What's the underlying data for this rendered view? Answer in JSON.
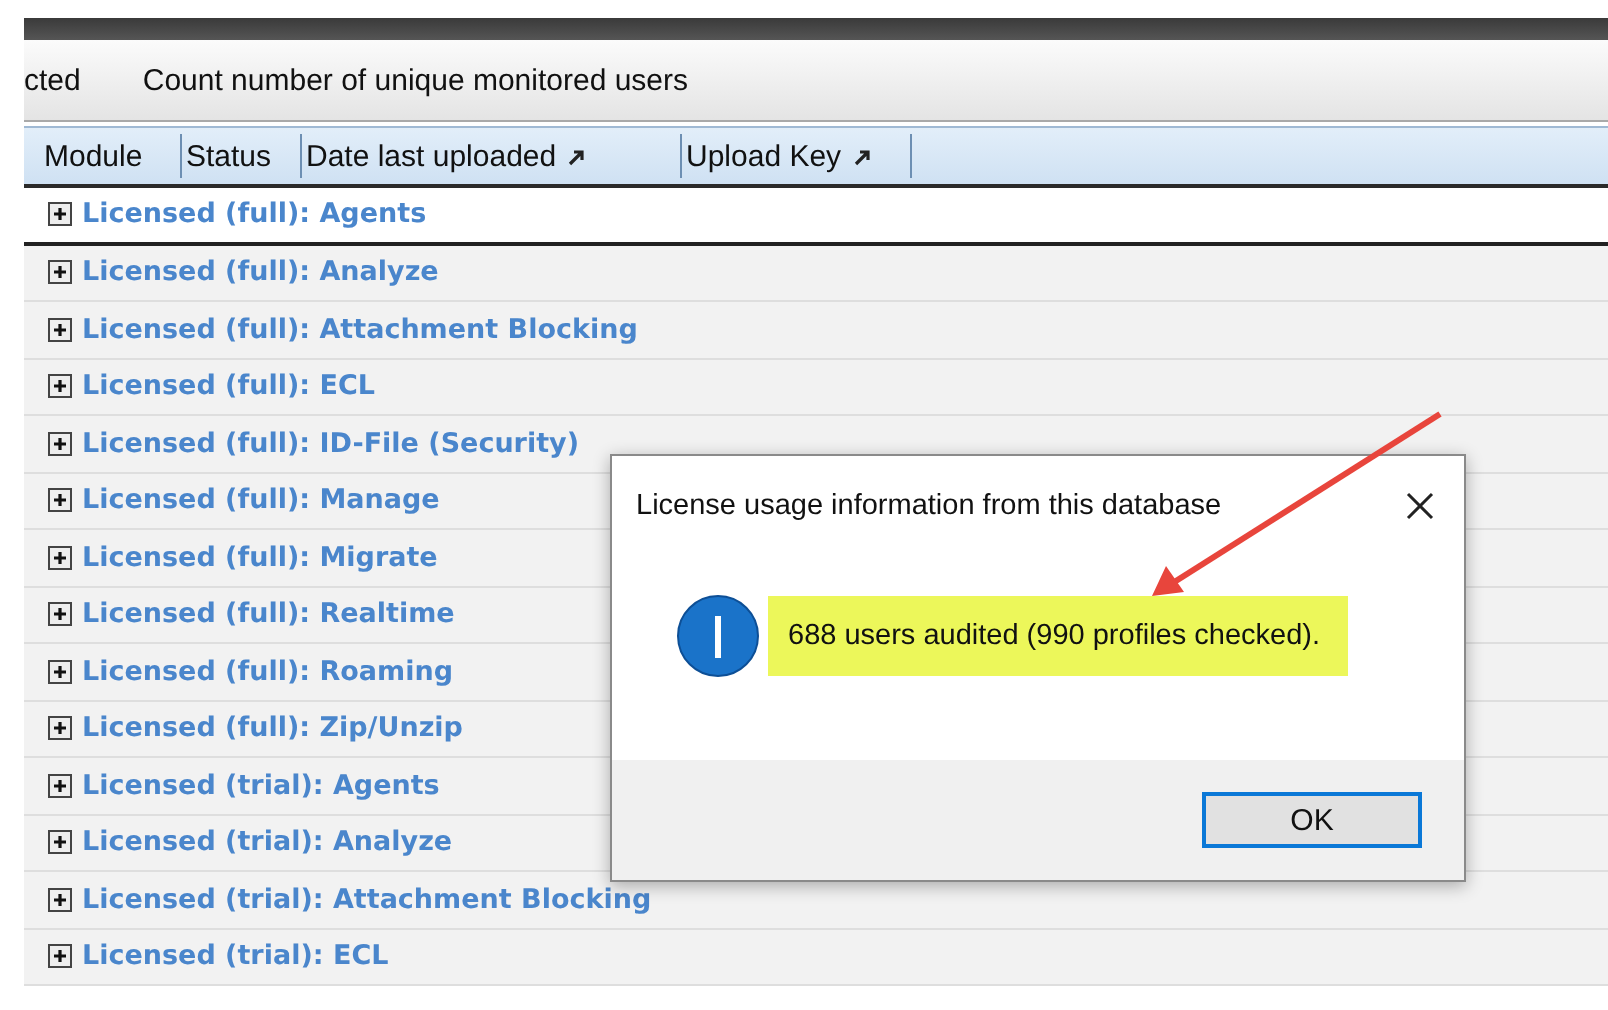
{
  "toolbar": {
    "items": [
      {
        "label": "cted"
      },
      {
        "label": "Count number of unique monitored users"
      }
    ]
  },
  "table": {
    "columns": [
      {
        "label": "Module",
        "sortable": false
      },
      {
        "label": "Status",
        "sortable": false
      },
      {
        "label": "Date last uploaded",
        "sortable": true
      },
      {
        "label": "Upload Key",
        "sortable": true
      }
    ],
    "rows": [
      {
        "label": "Licensed (full): Agents",
        "selected": true
      },
      {
        "label": "Licensed (full): Analyze",
        "selected": false
      },
      {
        "label": "Licensed (full): Attachment Blocking",
        "selected": false
      },
      {
        "label": "Licensed (full): ECL",
        "selected": false
      },
      {
        "label": "Licensed (full): ID-File (Security)",
        "selected": false
      },
      {
        "label": "Licensed (full): Manage",
        "selected": false
      },
      {
        "label": "Licensed (full): Migrate",
        "selected": false
      },
      {
        "label": "Licensed (full): Realtime",
        "selected": false
      },
      {
        "label": "Licensed (full): Roaming",
        "selected": false
      },
      {
        "label": "Licensed (full): Zip/Unzip",
        "selected": false
      },
      {
        "label": "Licensed (trial): Agents",
        "selected": false
      },
      {
        "label": "Licensed (trial): Analyze",
        "selected": false
      },
      {
        "label": "Licensed (trial): Attachment Blocking",
        "selected": false
      },
      {
        "label": "Licensed (trial): ECL",
        "selected": false
      }
    ]
  },
  "dialog": {
    "title": "License usage information from this database",
    "message": "688 users audited (990 profiles checked).",
    "highlighted": true,
    "button": "OK"
  }
}
